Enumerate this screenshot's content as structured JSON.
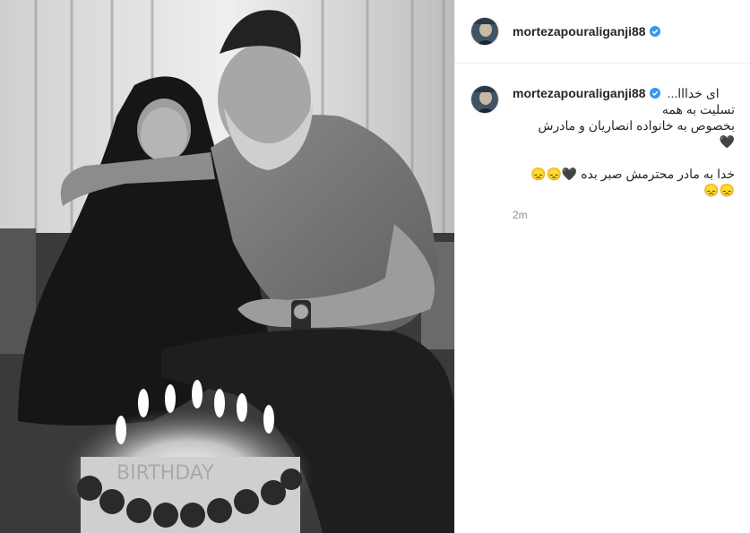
{
  "post": {
    "image_alt": "Black and white photo of a man and elderly woman with birthday cake",
    "image_icon": "photo",
    "cake_text": "BIRTHDAY"
  },
  "header": {
    "username": "mortezapouraliganji88",
    "verified_icon": "verified-badge-icon",
    "accent": "#3897f0"
  },
  "caption": {
    "username": "mortezapouraliganji88",
    "line1": "ای خدااا...",
    "line2": "تسلیت به همه",
    "line3": "بخصوص به خانواده انصاریان و مادرش",
    "line4": "🖤",
    "line5": "خدا به مادر محترمش صبر بده 🖤😞😞",
    "line6": "😞😞",
    "time": "2m"
  }
}
